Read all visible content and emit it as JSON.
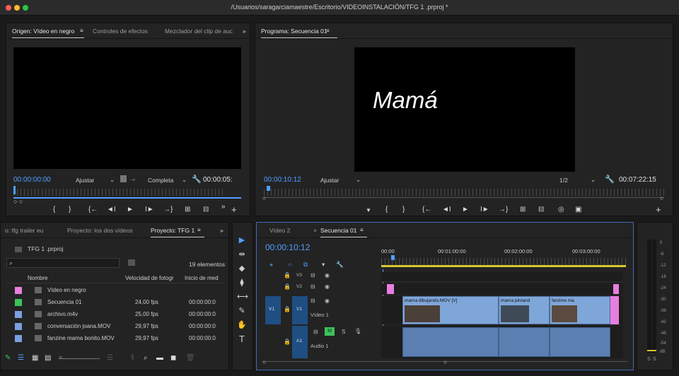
{
  "window": {
    "title": "/Usuarios/saragarciamaestre/Escritorio/VIDEOINSTALACIÓN/TFG 1 .prproj *",
    "traffic_colors": [
      "#ff5f57",
      "#febc2e",
      "#28c840"
    ]
  },
  "source_panel": {
    "tabs": [
      "Origen: Vídeo en negro",
      "Controles de efectos",
      "Mezclador del clip de auc"
    ],
    "timecode": "00:00:00:00",
    "fit": "Ajustar",
    "resolution": "Completa",
    "duration": "00:00:05:",
    "controls": [
      "{",
      "}",
      "{←",
      "◄I",
      "►",
      "I►",
      "→}",
      "⊞",
      "⊟",
      "»",
      "+"
    ]
  },
  "program_panel": {
    "tab": "Programa: Secuencia 01",
    "overlay_text": "Mamá",
    "timecode": "00:00:10:12",
    "fit": "Ajustar",
    "resolution": "1/2",
    "duration": "00:07:22:15",
    "controls": [
      "▼",
      "{",
      "}",
      "{←",
      "◄I",
      "►",
      "I►",
      "→}",
      "⊞",
      "⊟",
      "◎",
      "▣",
      "+"
    ]
  },
  "project_panel": {
    "tabs": [
      "o: tfg trailer eu",
      "Proyecto: los dos vídeos",
      "Proyecto: TFG 1"
    ],
    "project_file": "TFG 1 .prproj",
    "count": "19 elementos",
    "columns": [
      "Nombre",
      "Velocidad de fotogr",
      "Inicio de med"
    ],
    "items": [
      {
        "name": "Vídeo en negro",
        "fps": "",
        "start": "",
        "color": "#e87ee0"
      },
      {
        "name": "Secuencia 01",
        "fps": "24,00 fps",
        "start": "00:00:00:0",
        "color": "#3cc25a"
      },
      {
        "name": "archivo.m4v",
        "fps": "25,00 fps",
        "start": "00:00:00:0",
        "color": "#7aa0e0"
      },
      {
        "name": "conversación joana.MOV",
        "fps": "29,97 fps",
        "start": "00:00:00:0",
        "color": "#7aa0e0"
      },
      {
        "name": "fanzine mama bonito.MOV",
        "fps": "29,97 fps",
        "start": "00:00:00:0",
        "color": "#7aa0e0"
      }
    ]
  },
  "timeline": {
    "tabs": [
      "Vídeo 2",
      "Secuencia 01"
    ],
    "timecode": "00:00:10:12",
    "ruler": [
      "00:00",
      "00:01:00:00",
      "00:02:00:00",
      "00:03:00:00"
    ],
    "video_tracks": [
      "V3",
      "V2",
      "V1"
    ],
    "audio_tracks": [
      "A1"
    ],
    "v1_source": "V1",
    "a1_label": "Audio 1",
    "v1_name": "Vídeo 1",
    "mute": "M",
    "solo": "S",
    "clips": [
      "mama dibujando.MOV [V]",
      "mama pintand",
      "fanzine ma"
    ]
  },
  "audio_meter": {
    "scale": [
      "0",
      "-6",
      "-12",
      "-18",
      "-24",
      "-30",
      "-36",
      "-42",
      "-48",
      "-54",
      "dB"
    ],
    "buttons": [
      "S",
      "S"
    ]
  },
  "tools": [
    "▶",
    "⇹",
    "◆",
    "⟷",
    "✎",
    "✋",
    "T"
  ]
}
